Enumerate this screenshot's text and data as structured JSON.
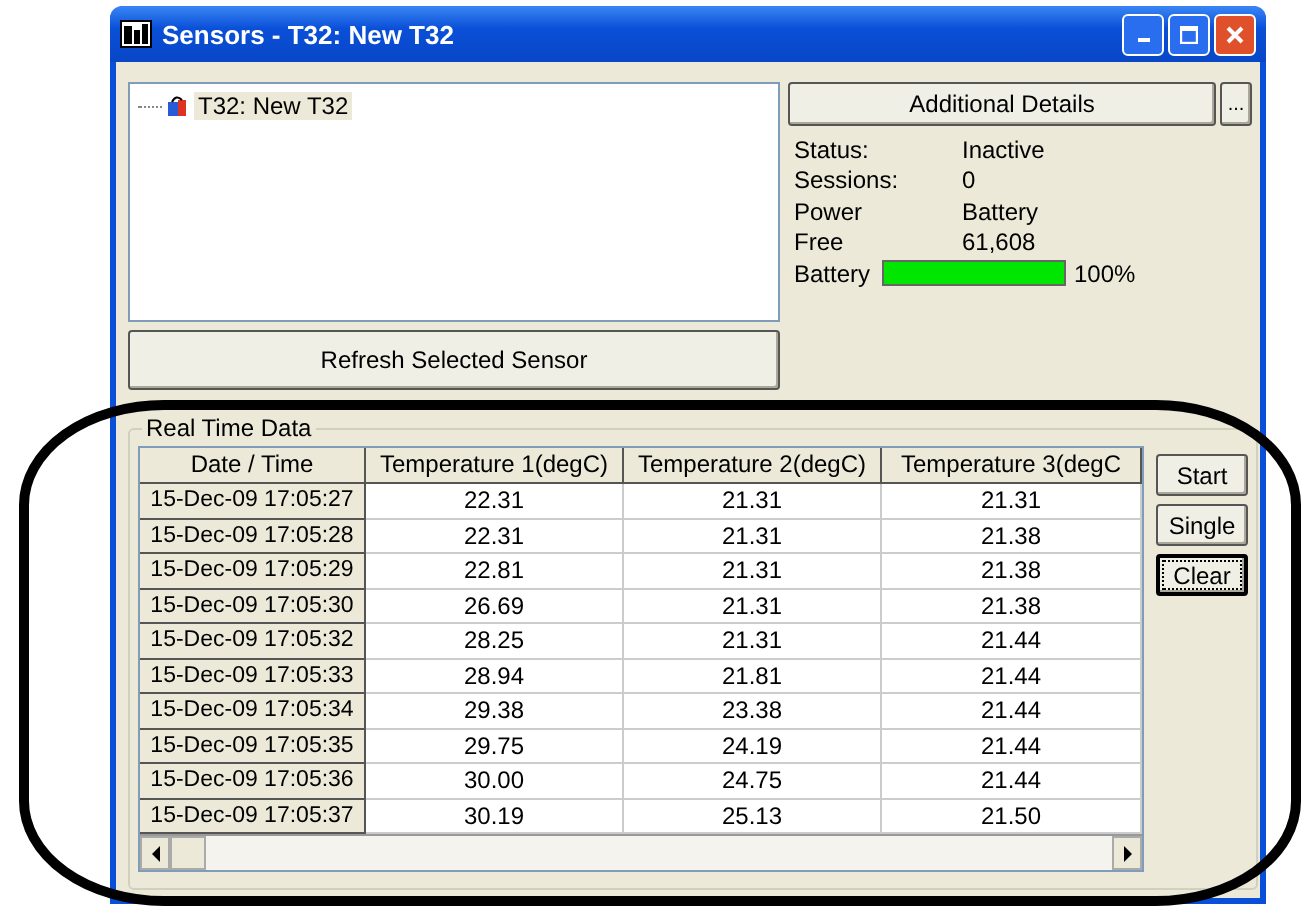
{
  "window": {
    "title": "Sensors - T32: New T32"
  },
  "tree": {
    "items": [
      {
        "label": "T32: New T32",
        "selected": true
      }
    ]
  },
  "refresh_button": "Refresh Selected Sensor",
  "details_button": "Additional Details",
  "more_button": "...",
  "details": [
    {
      "label": "Status:",
      "value": "Inactive"
    },
    {
      "label": "Sessions:",
      "value": "0"
    },
    {
      "label": "Power",
      "value": "Battery"
    },
    {
      "label": "Free",
      "value": "61,608"
    }
  ],
  "battery": {
    "label": "Battery",
    "level": 1.0,
    "reading": "100%"
  },
  "real_time": {
    "title": "Real Time Data",
    "columns": [
      "Date / Time",
      "Temperature 1(degC)",
      "Temperature 2(degC)",
      "Temperature 3(degC"
    ],
    "rows": [
      [
        "15-Dec-09 17:05:27",
        "22.31",
        "21.31",
        "21.31"
      ],
      [
        "15-Dec-09 17:05:28",
        "22.31",
        "21.31",
        "21.38"
      ],
      [
        "15-Dec-09 17:05:29",
        "22.81",
        "21.31",
        "21.38"
      ],
      [
        "15-Dec-09 17:05:30",
        "26.69",
        "21.31",
        "21.38"
      ],
      [
        "15-Dec-09 17:05:32",
        "28.25",
        "21.31",
        "21.44"
      ],
      [
        "15-Dec-09 17:05:33",
        "28.94",
        "21.81",
        "21.44"
      ],
      [
        "15-Dec-09 17:05:34",
        "29.38",
        "23.38",
        "21.44"
      ],
      [
        "15-Dec-09 17:05:35",
        "29.75",
        "24.19",
        "21.44"
      ],
      [
        "15-Dec-09 17:05:36",
        "30.00",
        "24.75",
        "21.44"
      ],
      [
        "15-Dec-09 17:05:37",
        "30.19",
        "25.13",
        "21.50"
      ]
    ]
  },
  "buttons": [
    {
      "label": "Start",
      "focused": false
    },
    {
      "label": "Single",
      "focused": false
    },
    {
      "label": "Clear",
      "focused": true
    }
  ]
}
